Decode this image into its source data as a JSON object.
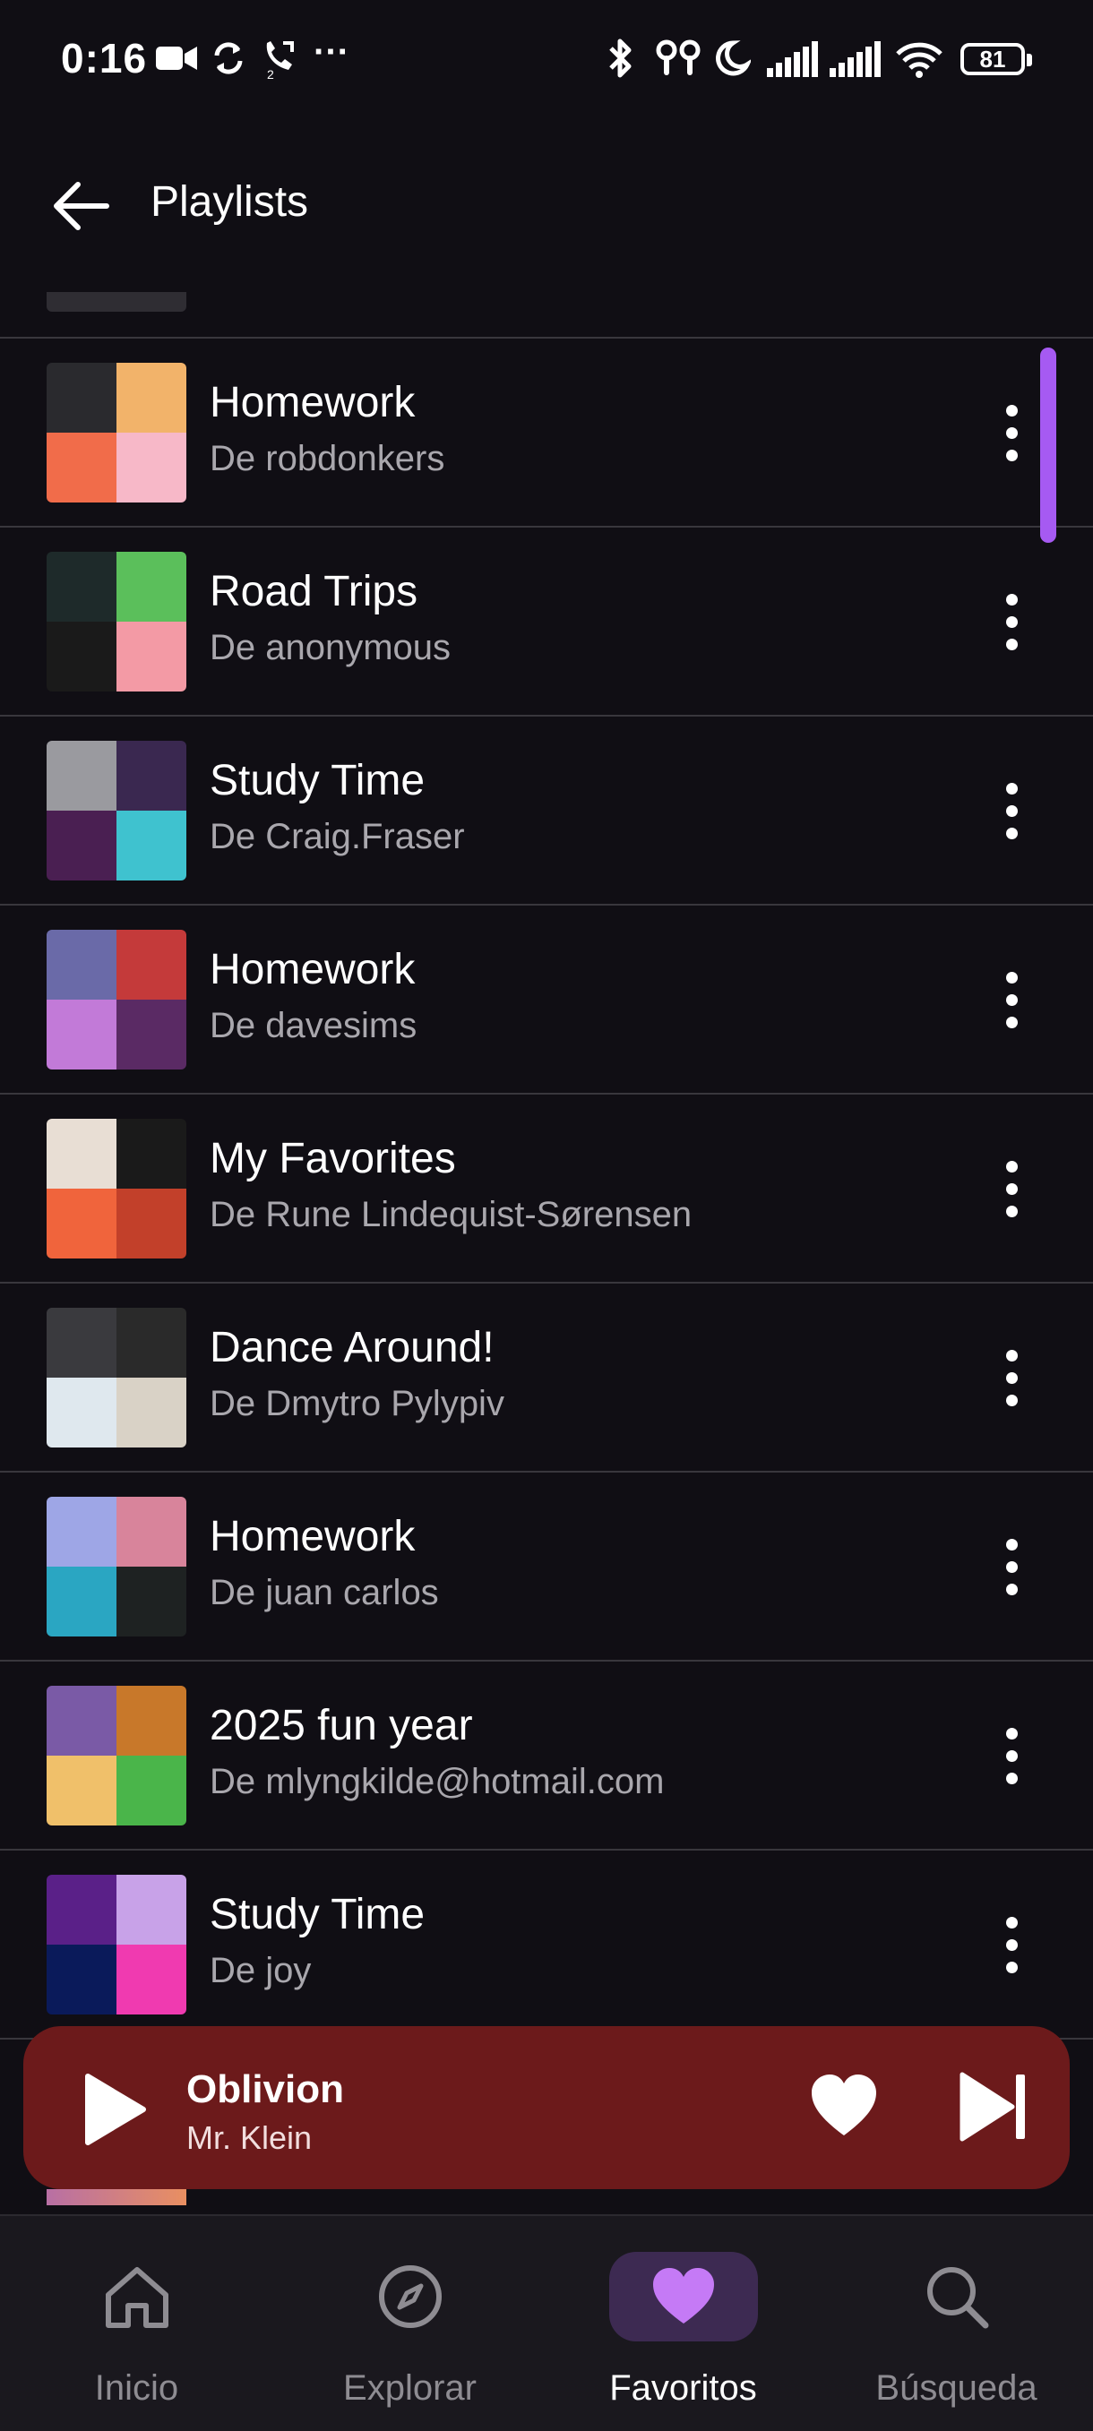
{
  "status_bar": {
    "time": "0:16",
    "ellipsis": "···",
    "battery": "81"
  },
  "header": {
    "title": "Playlists"
  },
  "playlists": [
    {
      "title": "Homework",
      "subtitle": "De robdonkers",
      "colors": [
        "#2a2a2e",
        "#f2b36a",
        "#f16c4a",
        "#f7b8c8"
      ]
    },
    {
      "title": "Road Trips",
      "subtitle": "De anonymous",
      "colors": [
        "#1e2a2a",
        "#5bbf5b",
        "#1a1a1a",
        "#f39aa5"
      ]
    },
    {
      "title": "Study Time",
      "subtitle": "De Craig.Fraser",
      "colors": [
        "#9a9a9f",
        "#3a2850",
        "#4a1f52",
        "#3fc2cf"
      ]
    },
    {
      "title": "Homework",
      "subtitle": "De davesims",
      "colors": [
        "#6a6aa8",
        "#c43a3a",
        "#c27ad8",
        "#5a2a64"
      ]
    },
    {
      "title": "My Favorites",
      "subtitle": "De Rune Lindequist-Sørensen",
      "colors": [
        "#e8ded4",
        "#1a1a1a",
        "#f0643c",
        "#c2402a"
      ]
    },
    {
      "title": "Dance Around!",
      "subtitle": "De Dmytro Pylypiv",
      "colors": [
        "#3a3a3e",
        "#2a2a2a",
        "#dfe8ee",
        "#d9d2c6"
      ]
    },
    {
      "title": "Homework",
      "subtitle": "De juan carlos",
      "colors": [
        "#9ea6e6",
        "#d8849b",
        "#2aa6c2",
        "#1e2222"
      ]
    },
    {
      "title": "2025 fun year",
      "subtitle": "De mlyngkilde@hotmail.com",
      "colors": [
        "#7a5aa6",
        "#c8782a",
        "#f0c06a",
        "#4ab54a"
      ]
    },
    {
      "title": "Study Time",
      "subtitle": "De joy",
      "colors": [
        "#5a2088",
        "#c8a2e8",
        "#0a1a5a",
        "#f03ab0"
      ]
    }
  ],
  "now_playing": {
    "title": "Oblivion",
    "artist": "Mr. Klein"
  },
  "bottom_nav": [
    {
      "label": "Inicio",
      "icon": "home-icon",
      "active": false
    },
    {
      "label": "Explorar",
      "icon": "compass-icon",
      "active": false
    },
    {
      "label": "Favoritos",
      "icon": "heart-icon",
      "active": true
    },
    {
      "label": "Búsqueda",
      "icon": "search-icon",
      "active": false
    }
  ],
  "colors": {
    "background": "#100e14",
    "accent": "#a65af2",
    "player_bg": "#6c1a1b",
    "nav_bg": "#1a181e",
    "nav_active_pill": "#3d2a52"
  }
}
